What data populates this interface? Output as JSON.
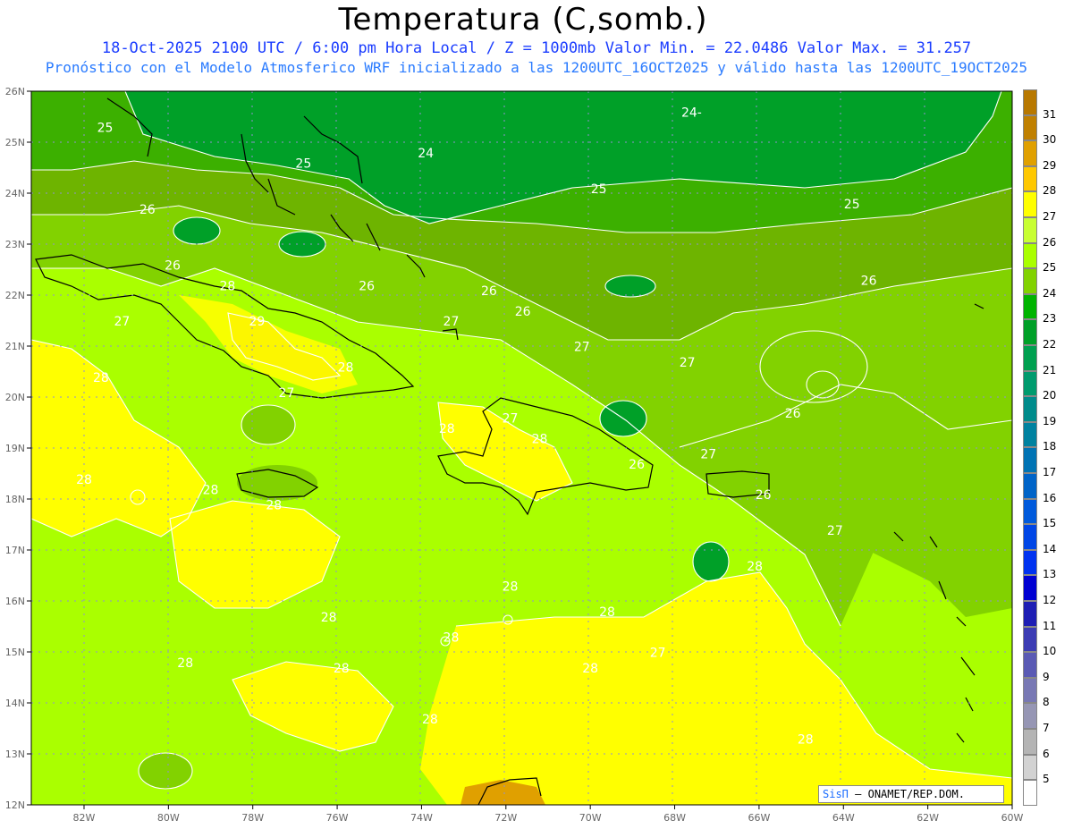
{
  "title": "Temperatura (C,somb.)",
  "subtitle1": "18-Oct-2025  2100 UTC / 6:00 pm Hora Local / Z = 1000mb   Valor Min. = 22.0486  Valor Max. = 31.257",
  "subtitle2": "Pronóstico con el Modelo Atmosferico WRF inicializado a las 1200UTC_16OCT2025 y válido hasta las  1200UTC_19OCT2025",
  "credit": {
    "brand": "SisΠ",
    "text": "– ONAMET/REP.DOM."
  },
  "chart_data": {
    "type": "heatmap",
    "x_ticks": [
      "82W",
      "80W",
      "78W",
      "76W",
      "74W",
      "72W",
      "70W",
      "68W",
      "66W",
      "64W",
      "62W",
      "60W"
    ],
    "y_ticks": [
      "26N",
      "25N",
      "24N",
      "23N",
      "22N",
      "21N",
      "20N",
      "19N",
      "18N",
      "17N",
      "16N",
      "15N",
      "14N",
      "13N",
      "12N"
    ],
    "xlim": [
      "83.2W",
      "60W"
    ],
    "ylim": [
      "12N",
      "26N"
    ],
    "grid": true,
    "contour_labels": [
      {
        "value": "25",
        "lon": -81.5,
        "lat": 25.2
      },
      {
        "value": "24",
        "lon": -73.9,
        "lat": 24.7
      },
      {
        "value": "24-",
        "lon": -67.6,
        "lat": 25.5
      },
      {
        "value": "25",
        "lon": -76.8,
        "lat": 24.5
      },
      {
        "value": "25",
        "lon": -69.8,
        "lat": 24.0
      },
      {
        "value": "25",
        "lon": -63.8,
        "lat": 23.7
      },
      {
        "value": "26",
        "lon": -80.5,
        "lat": 23.6
      },
      {
        "value": "26",
        "lon": -79.9,
        "lat": 22.5
      },
      {
        "value": "26",
        "lon": -75.3,
        "lat": 22.1
      },
      {
        "value": "26",
        "lon": -72.4,
        "lat": 22.0
      },
      {
        "value": "26",
        "lon": -71.6,
        "lat": 21.6
      },
      {
        "value": "26",
        "lon": -63.4,
        "lat": 22.2
      },
      {
        "value": "28",
        "lon": -78.6,
        "lat": 22.1
      },
      {
        "value": "29",
        "lon": -77.9,
        "lat": 21.4
      },
      {
        "value": "27",
        "lon": -81.1,
        "lat": 21.4
      },
      {
        "value": "27",
        "lon": -73.3,
        "lat": 21.4
      },
      {
        "value": "27",
        "lon": -70.2,
        "lat": 20.9
      },
      {
        "value": "27",
        "lon": -67.7,
        "lat": 20.6
      },
      {
        "value": "28",
        "lon": -81.6,
        "lat": 20.3
      },
      {
        "value": "28",
        "lon": -75.8,
        "lat": 20.5
      },
      {
        "value": "27",
        "lon": -77.2,
        "lat": 20.0
      },
      {
        "value": "27",
        "lon": -71.9,
        "lat": 19.5
      },
      {
        "value": "28",
        "lon": -73.4,
        "lat": 19.3
      },
      {
        "value": "28",
        "lon": -71.2,
        "lat": 19.1
      },
      {
        "value": "26",
        "lon": -65.2,
        "lat": 19.6
      },
      {
        "value": "26",
        "lon": -68.9,
        "lat": 18.6
      },
      {
        "value": "27",
        "lon": -67.2,
        "lat": 18.8
      },
      {
        "value": "26",
        "lon": -65.9,
        "lat": 18.0
      },
      {
        "value": "28",
        "lon": -82.0,
        "lat": 18.3
      },
      {
        "value": "28",
        "lon": -79.0,
        "lat": 18.1
      },
      {
        "value": "28",
        "lon": -77.5,
        "lat": 17.8
      },
      {
        "value": "27",
        "lon": -64.2,
        "lat": 17.3
      },
      {
        "value": "28",
        "lon": -66.1,
        "lat": 16.6
      },
      {
        "value": "28",
        "lon": -71.9,
        "lat": 16.2
      },
      {
        "value": "28",
        "lon": -76.2,
        "lat": 15.6
      },
      {
        "value": "28",
        "lon": -69.6,
        "lat": 15.7
      },
      {
        "value": "28",
        "lon": -73.3,
        "lat": 15.2
      },
      {
        "value": "28",
        "lon": -79.6,
        "lat": 14.7
      },
      {
        "value": "28",
        "lon": -75.9,
        "lat": 14.6
      },
      {
        "value": "28",
        "lon": -70.0,
        "lat": 14.6
      },
      {
        "value": "27",
        "lon": -68.4,
        "lat": 14.9
      },
      {
        "value": "28",
        "lon": -73.8,
        "lat": 13.6
      },
      {
        "value": "28",
        "lon": -64.9,
        "lat": 13.2
      }
    ],
    "colorbar": {
      "levels": [
        "31",
        "30",
        "29",
        "28",
        "27",
        "26",
        "25",
        "24",
        "23",
        "22",
        "21",
        "20",
        "19",
        "18",
        "17",
        "16",
        "15",
        "14",
        "13",
        "12",
        "11",
        "10",
        "9",
        "8",
        "7",
        "6",
        "5"
      ],
      "colors": [
        "#c08000",
        "#e0a000",
        "#ffc800",
        "#ffff00",
        "#c8ff32",
        "#aaff00",
        "#82d200",
        "#00b400",
        "#00a028",
        "#00a050",
        "#009b6e",
        "#008c8c",
        "#0082a0",
        "#0073b4",
        "#0064c8",
        "#005adc",
        "#0046e6",
        "#0032f0",
        "#0000d2",
        "#1e1eb4",
        "#3c3cb4",
        "#5a5ab4",
        "#7878b4",
        "#9696b4",
        "#b4b4b4",
        "#d2d2d2",
        "#ffffff"
      ]
    },
    "value_min": 22.0486,
    "value_max": 31.257
  }
}
